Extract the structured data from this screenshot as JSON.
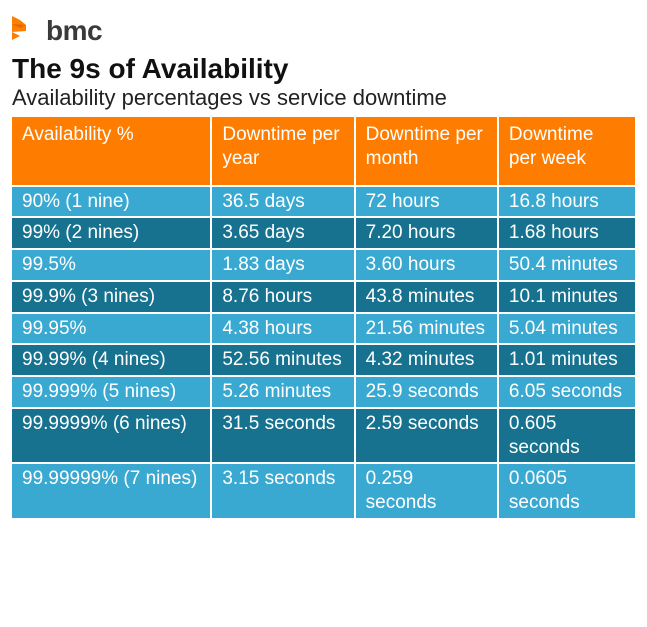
{
  "logo": {
    "text": "bmc",
    "accent": "#fe7d00"
  },
  "title": "The 9s of Availability",
  "subtitle": "Availability percentages vs service downtime",
  "table": {
    "headers": [
      "Availability %",
      "Downtime per year",
      "Downtime per month",
      "Downtime per week"
    ],
    "rows": [
      {
        "avail": "90% (1 nine)",
        "year": "36.5 days",
        "month": "72 hours",
        "week": "16.8 hours"
      },
      {
        "avail": "99% (2 nines)",
        "year": "3.65 days",
        "month": "7.20 hours",
        "week": "1.68 hours"
      },
      {
        "avail": "99.5%",
        "year": "1.83 days",
        "month": "3.60 hours",
        "week": "50.4 minutes"
      },
      {
        "avail": "99.9% (3 nines)",
        "year": "8.76 hours",
        "month": "43.8 minutes",
        "week": "10.1 minutes"
      },
      {
        "avail": "99.95%",
        "year": "4.38 hours",
        "month": "21.56 minutes",
        "week": "5.04 minutes"
      },
      {
        "avail": "99.99% (4 nines)",
        "year": "52.56 minutes",
        "month": "4.32 minutes",
        "week": "1.01 minutes"
      },
      {
        "avail": "99.999% (5 nines)",
        "year": "5.26 minutes",
        "month": "25.9 seconds",
        "week": "6.05 seconds"
      },
      {
        "avail": "99.9999% (6 nines)",
        "year": "31.5 seconds",
        "month": "2.59 seconds",
        "week": "0.605 seconds"
      },
      {
        "avail": "99.99999% (7 nines)",
        "year": "3.15 seconds",
        "month": "0.259 seconds",
        "week": "0.0605 seconds"
      }
    ]
  },
  "chart_data": {
    "type": "table",
    "title": "The 9s of Availability",
    "columns": [
      "Availability %",
      "Downtime per year",
      "Downtime per month",
      "Downtime per week"
    ],
    "rows": [
      [
        "90% (1 nine)",
        "36.5 days",
        "72 hours",
        "16.8 hours"
      ],
      [
        "99% (2 nines)",
        "3.65 days",
        "7.20 hours",
        "1.68 hours"
      ],
      [
        "99.5%",
        "1.83 days",
        "3.60 hours",
        "50.4 minutes"
      ],
      [
        "99.9% (3 nines)",
        "8.76 hours",
        "43.8 minutes",
        "10.1 minutes"
      ],
      [
        "99.95%",
        "4.38 hours",
        "21.56 minutes",
        "5.04 minutes"
      ],
      [
        "99.99% (4 nines)",
        "52.56 minutes",
        "4.32 minutes",
        "1.01 minutes"
      ],
      [
        "99.999% (5 nines)",
        "5.26 minutes",
        "25.9 seconds",
        "6.05 seconds"
      ],
      [
        "99.9999% (6 nines)",
        "31.5 seconds",
        "2.59 seconds",
        "0.605 seconds"
      ],
      [
        "99.99999% (7 nines)",
        "3.15 seconds",
        "0.259 seconds",
        "0.0605 seconds"
      ]
    ]
  }
}
